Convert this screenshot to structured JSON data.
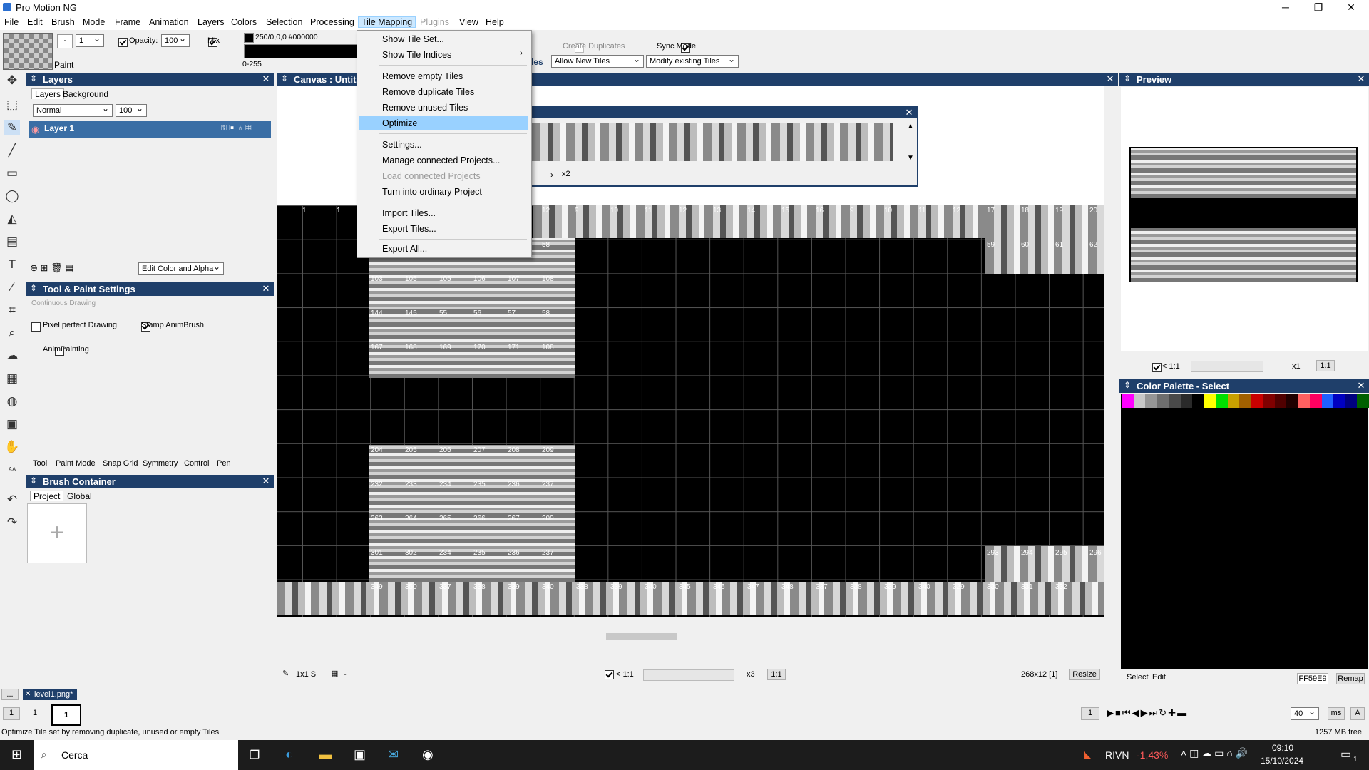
{
  "window": {
    "title": "Pro Motion NG",
    "minimize": "─",
    "maximize": "❐",
    "close": "✕"
  },
  "menubar": [
    "File",
    "Edit",
    "Brush",
    "Mode",
    "Frame",
    "Animation",
    "Layers",
    "Colors",
    "Selection",
    "Processing",
    "Tile Mapping",
    "Plugins",
    "View",
    "Help"
  ],
  "toolbar": {
    "paint_label": "Paint",
    "brush_size": "1",
    "opacity_label": "Opacity:",
    "opacity_value": "100",
    "mix_label": "Mix",
    "color_value": "250/0,0,0 #000000",
    "range_label": "0-255",
    "create_duplicates": "Create Duplicates",
    "sync_mode": "Sync Mode",
    "tiles_suffix": "les",
    "allow_new_tiles": "Allow New Tiles",
    "modify_existing": "Modify existing Tiles"
  },
  "tile_mapping_menu": [
    {
      "label": "Show Tile Set...",
      "state": "normal"
    },
    {
      "label": "Show Tile Indices",
      "state": "submenu"
    },
    {
      "label": "Remove empty Tiles",
      "state": "normal"
    },
    {
      "label": "Remove duplicate Tiles",
      "state": "normal"
    },
    {
      "label": "Remove unused Tiles",
      "state": "normal"
    },
    {
      "label": "Optimize",
      "state": "highlighted"
    },
    {
      "label": "Settings...",
      "state": "normal"
    },
    {
      "label": "Manage connected Projects...",
      "state": "normal"
    },
    {
      "label": "Load connected Projects",
      "state": "disabled"
    },
    {
      "label": "Turn into ordinary Project",
      "state": "normal"
    },
    {
      "label": "Import Tiles...",
      "state": "normal"
    },
    {
      "label": "Export Tiles...",
      "state": "normal"
    },
    {
      "label": "Export All...",
      "state": "normal"
    }
  ],
  "layers_panel": {
    "title": "Layers",
    "tabs": [
      "Layers",
      "Background"
    ],
    "blend_mode": "Normal",
    "opacity": "100",
    "layer_name": "Layer 1",
    "edit_mode": "Edit Color and Alpha"
  },
  "tool_paint_settings": {
    "title": "Tool & Paint Settings",
    "subtitle": "Continuous Drawing",
    "pixel_perfect": "Pixel perfect Drawing",
    "stamp_animbrush": "Stamp AnimBrush",
    "animpainting": "AnimPainting",
    "tabs": [
      "Tool",
      "Paint Mode",
      "Snap Grid",
      "Symmetry",
      "Control",
      "Pen"
    ]
  },
  "brush_container": {
    "title": "Brush Container",
    "tabs": [
      "Project",
      "Global"
    ],
    "add_symbol": "+"
  },
  "canvas": {
    "title": "Canvas : Untit",
    "tileset_zoom": "x2",
    "zoom_left": "< 1:1",
    "zoom_factor": "x3",
    "zoom_ratio": "1:1",
    "brush_info": "1x1 S",
    "grid_info": "-",
    "size_info": "268x12 [1]",
    "resize_label": "Resize",
    "tile_numbers": [
      "1",
      "1",
      "1",
      "1",
      "12",
      "9",
      "10",
      "11",
      "12",
      "13",
      "14",
      "15",
      "16",
      "9",
      "10",
      "11",
      "12",
      "17",
      "18",
      "19",
      "20",
      "58",
      "59",
      "60",
      "61",
      "62",
      "103",
      "105",
      "105",
      "106",
      "107",
      "108",
      "144",
      "145",
      "55",
      "56",
      "57",
      "58",
      "167",
      "168",
      "169",
      "170",
      "171",
      "108",
      "204",
      "205",
      "206",
      "207",
      "208",
      "209",
      "232",
      "233",
      "234",
      "235",
      "236",
      "237",
      "263",
      "264",
      "265",
      "266",
      "267",
      "209",
      "301",
      "302",
      "234",
      "235",
      "236",
      "237",
      "293",
      "294",
      "295",
      "296",
      "349",
      "350",
      "337",
      "338",
      "339",
      "340",
      "338",
      "339",
      "340",
      "345",
      "346",
      "347",
      "348",
      "337",
      "338",
      "339",
      "340",
      "329",
      "330",
      "331",
      "332"
    ]
  },
  "preview_panel": {
    "title": "Preview",
    "zoom_left": "< 1:1",
    "zoom_factor": "x1",
    "zoom_ratio": "1:1"
  },
  "palette_panel": {
    "title": "Color Palette - Select",
    "colors": [
      "#ff00ff",
      "#c8c8c8",
      "#969696",
      "#6e6e6e",
      "#4a4a4a",
      "#2a2a2a",
      "#000000",
      "#ffff00",
      "#00e000",
      "#c8a000",
      "#a06000",
      "#c80000",
      "#800000",
      "#500000",
      "#200000",
      "#ff6060",
      "#ff0060",
      "#2060ff",
      "#0000c0",
      "#000080",
      "#006000"
    ],
    "select_tab": "Select",
    "edit_tab": "Edit",
    "hex_value": "FF59E9",
    "remap_label": "Remap"
  },
  "document_tab": {
    "ellipsis": "...",
    "name": "level1.png*"
  },
  "frames": {
    "start": "1",
    "current": "1",
    "frame_box": "1",
    "frame_index": "1",
    "speed": "40",
    "unit": "ms",
    "mode": "A"
  },
  "status": {
    "message": "Optimize Tile set by removing duplicate, unused or empty Tiles",
    "memory": "1257 MB free"
  },
  "taskbar": {
    "search": "Cerca",
    "ticker": "RIVN",
    "ticker_change": "-1,43%",
    "time": "09:10",
    "date": "15/10/2024",
    "notifications": "1"
  }
}
